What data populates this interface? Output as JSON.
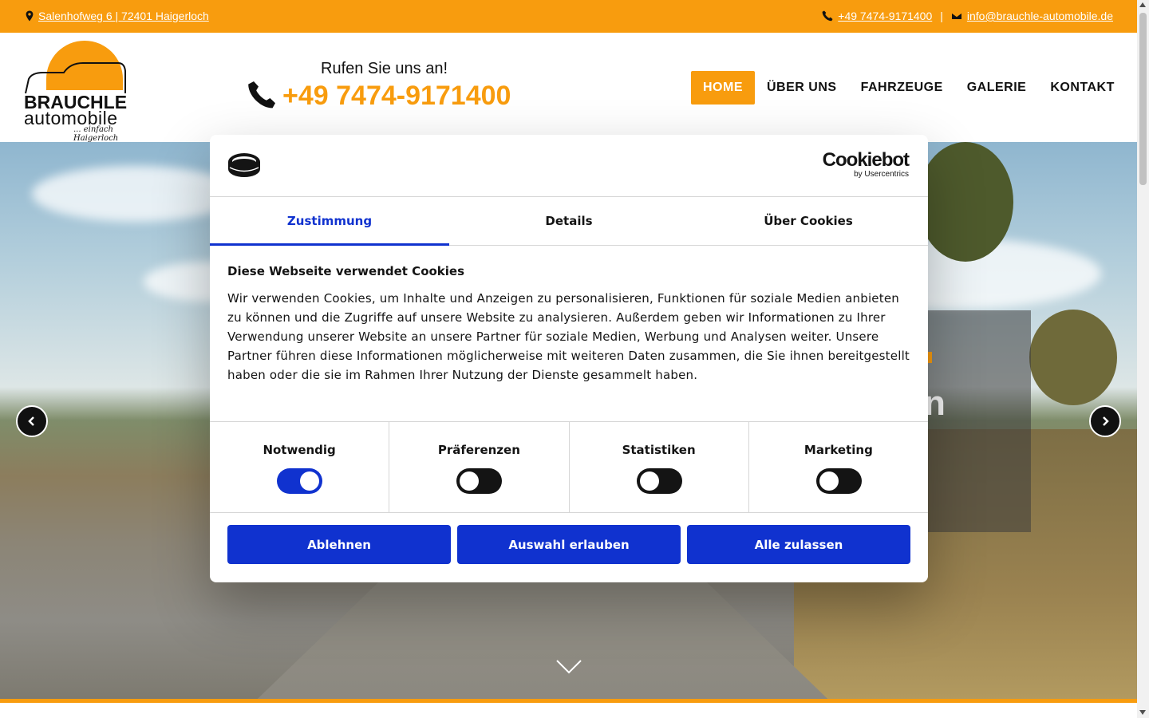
{
  "topbar": {
    "address": "Salenhofweg 6 | 72401 Haigerloch",
    "phone": "+49 7474-9171400",
    "separator": "|",
    "email": "info@brauchle-automobile.de"
  },
  "header": {
    "logo": {
      "brand": "BRAUCHLE",
      "sub": "automobile",
      "tagline": "... einfach Haigerloch"
    },
    "call_label": "Rufen Sie uns an!",
    "call_number": "+49 7474-9171400",
    "nav": [
      {
        "label": "HOME",
        "active": true
      },
      {
        "label": "ÜBER UNS",
        "active": false
      },
      {
        "label": "FAHRZEUGE",
        "active": false
      },
      {
        "label": "GALERIE",
        "active": false
      },
      {
        "label": "KONTAKT",
        "active": false
      }
    ]
  },
  "hero": {
    "overlay_text": "n"
  },
  "cookie_dialog": {
    "brand": "Cookiebot",
    "brand_sub": "by Usercentrics",
    "tabs": [
      {
        "label": "Zustimmung",
        "active": true
      },
      {
        "label": "Details",
        "active": false
      },
      {
        "label": "Über Cookies",
        "active": false
      }
    ],
    "heading": "Diese Webseite verwendet Cookies",
    "text": "Wir verwenden Cookies, um Inhalte und Anzeigen zu personalisieren, Funktionen für soziale Medien anbieten zu können und die Zugriffe auf unsere Website zu analysieren. Außerdem geben wir Informationen zu Ihrer Verwendung unserer Website an unsere Partner für soziale Medien, Werbung und Analysen weiter. Unsere Partner führen diese Informationen möglicherweise mit weiteren Daten zusammen, die Sie ihnen bereitgestellt haben oder die sie im Rahmen Ihrer Nutzung der Dienste gesammelt haben.",
    "toggles": [
      {
        "label": "Notwendig",
        "on": true
      },
      {
        "label": "Präferenzen",
        "on": false
      },
      {
        "label": "Statistiken",
        "on": false
      },
      {
        "label": "Marketing",
        "on": false
      }
    ],
    "buttons": {
      "decline": "Ablehnen",
      "allow_selection": "Auswahl erlauben",
      "allow_all": "Alle zulassen"
    }
  },
  "colors": {
    "accent": "#f89c0e",
    "cookiebot_blue": "#1032cf"
  }
}
